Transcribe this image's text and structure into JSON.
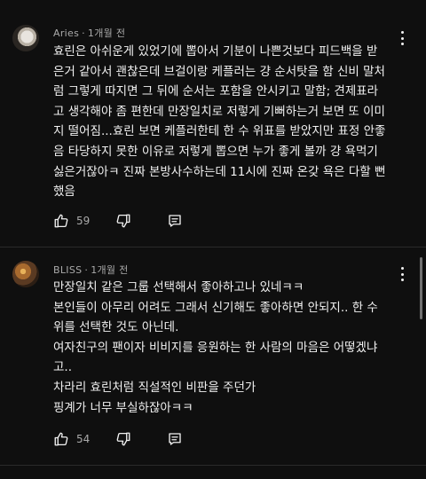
{
  "comments": [
    {
      "author": "Aries",
      "time": "1개월 전",
      "lines": [
        "효린은 아쉬운게 있었기에 뽑아서 기분이 나쁜것보다 피드백을 받",
        "은거 같아서 괜찮은데 브걸이랑 케플러는 걍 순서탓을 함 신비 말처",
        "럼 그렇게 따지면 그 뒤에 순서는 포함을 안시키고 말함; 견제표라",
        "고 생각해야 좀 편한데 만장일치로 저렇게 기뻐하는거 보면 또 이미",
        "지 떨어짐...효린 보면 케플러한테 한 수 위표를 받았지만 표정 안좋",
        "음 타당하지 못한 이유로 저렇게 뽑으면 누가 좋게 볼까 걍 욕먹기",
        "싫은거잖아ㅋ 진짜 본방사수하는데 11시에 진짜 온갖 욕은 다할 뻔",
        "했음"
      ],
      "likes": "59",
      "icons": {
        "like": "thumbs-up-icon",
        "dislike": "thumbs-down-icon",
        "reply": "reply-icon",
        "menu": "more-vert-icon"
      }
    },
    {
      "author": "BLISS",
      "time": "1개월 전",
      "lines": [
        "만장일치 같은 그룹 선택해서 좋아하고나 있네ㅋㅋ",
        "본인들이 아무리 어려도 그래서 신기해도 좋아하면 안되지.. 한 수",
        "위를 선택한 것도 아닌데.",
        "여자친구의 팬이자 비비지를 응원하는 한 사람의 마음은 어떻겠냐",
        "고..",
        "차라리 효린처럼 직설적인 비판을 주던가",
        "핑계가 너무 부실하잖아ㅋㅋ"
      ],
      "likes": "54",
      "icons": {
        "like": "thumbs-up-icon",
        "dislike": "thumbs-down-icon",
        "reply": "reply-icon",
        "menu": "more-vert-icon"
      }
    }
  ],
  "colors": {
    "background": "#0f0f0f",
    "text": "#f1f1f1",
    "secondary_text": "#aaaaaa",
    "divider": "#2a2a2a",
    "scrollbar": "#717171"
  }
}
